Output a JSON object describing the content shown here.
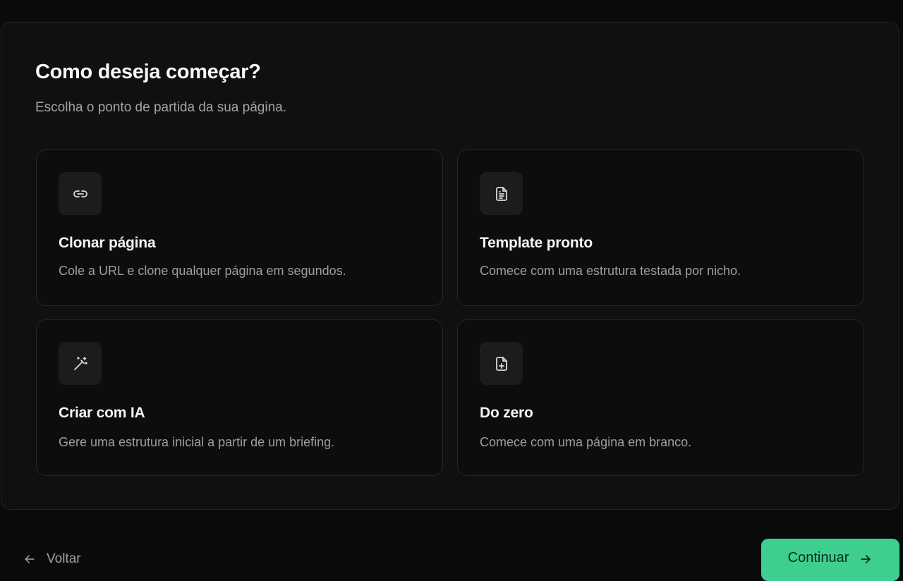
{
  "header": {
    "title": "Como deseja começar?",
    "subtitle": "Escolha o ponto de partida da sua página."
  },
  "options": [
    {
      "icon": "link-icon",
      "title": "Clonar página",
      "description": "Cole a URL e clone qualquer página em segundos."
    },
    {
      "icon": "document-icon",
      "title": "Template pronto",
      "description": "Comece com uma estrutura testada por nicho."
    },
    {
      "icon": "magic-wand-icon",
      "title": "Criar com IA",
      "description": "Gere uma estrutura inicial a partir de um briefing."
    },
    {
      "icon": "file-plus-icon",
      "title": "Do zero",
      "description": "Comece com uma página em branco."
    }
  ],
  "footer": {
    "back_label": "Voltar",
    "continue_label": "Continuar"
  },
  "colors": {
    "background": "#0a0a0a",
    "panel": "#101010",
    "accent": "#3ecf8e"
  }
}
